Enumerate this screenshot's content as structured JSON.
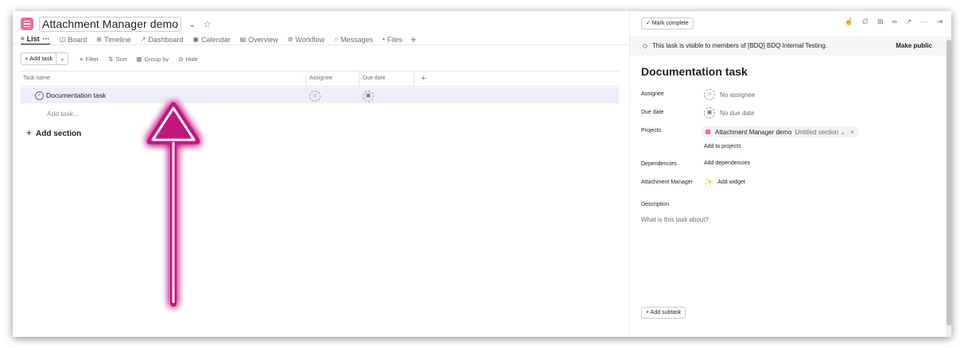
{
  "project": {
    "title": "Attachment Manager demo",
    "icon": "list-icon",
    "color": "#f06a99"
  },
  "tabs": [
    {
      "label": "List",
      "icon": "list-view-icon",
      "active": true,
      "extra": "···"
    },
    {
      "label": "Board",
      "icon": "board-icon"
    },
    {
      "label": "Timeline",
      "icon": "timeline-icon"
    },
    {
      "label": "Dashboard",
      "icon": "dashboard-icon"
    },
    {
      "label": "Calendar",
      "icon": "calendar-icon"
    },
    {
      "label": "Overview",
      "icon": "overview-icon"
    },
    {
      "label": "Workflow",
      "icon": "workflow-icon"
    },
    {
      "label": "Messages",
      "icon": "messages-icon"
    },
    {
      "label": "Files",
      "icon": "files-icon"
    }
  ],
  "toolbar": {
    "add_task": "+ Add task",
    "filter": "Filter",
    "sort": "Sort",
    "group_by": "Group by",
    "hide": "Hide"
  },
  "table": {
    "columns": [
      "Task name",
      "Assignee",
      "Due date"
    ],
    "rows": [
      {
        "name": "Documentation task"
      }
    ],
    "add_task_placeholder": "Add task...",
    "add_section": "Add section"
  },
  "annotation": {
    "type": "arrow",
    "color": "#c2187f"
  },
  "detail": {
    "mark_complete": "Mark complete",
    "visibility_text": "This task is visible to members of [BDQ] BDQ Internal Testing.",
    "make_public": "Make public",
    "title": "Documentation task",
    "fields": {
      "assignee_label": "Assignee",
      "assignee_value": "No assignee",
      "due_label": "Due date",
      "due_value": "No due date",
      "projects_label": "Projects",
      "project_name": "Attachment Manager demo",
      "project_section": "Untitled section",
      "add_to_projects": "Add to projects",
      "dependencies_label": "Dependencies",
      "add_dependencies": "Add dependencies",
      "attachment_label": "Attachment Manager",
      "add_widget": "Add widget",
      "description_label": "Description",
      "description_placeholder": "What is this task about?"
    },
    "add_subtask": "+ Add subtask"
  }
}
